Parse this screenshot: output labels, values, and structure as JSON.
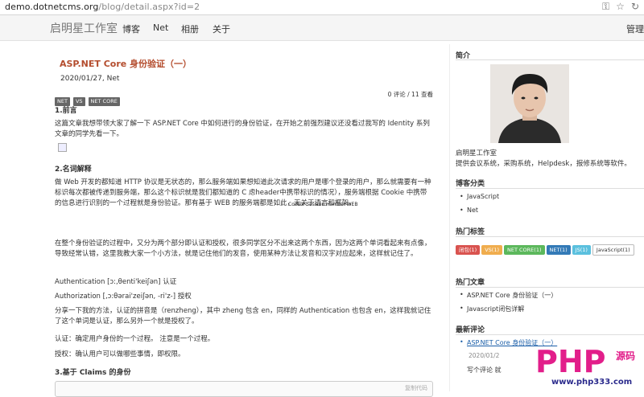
{
  "browser": {
    "url_host": "demo.dotnetcms.org",
    "url_path": "/blog/detail.aspx?id=2"
  },
  "nav": {
    "brand": "启明星工作室",
    "links": [
      "博客",
      "Net",
      "相册",
      "关于"
    ],
    "right": "管理"
  },
  "article": {
    "title": "ASP.NET Core 身份验证（一）",
    "date": "2020/01/27, Net",
    "tags": [
      "NET",
      "VS",
      "NET CORE"
    ],
    "meta": "0 评论 / 11 查看",
    "h1": "1.前言",
    "p1": "这篇文章我想带领大家了解一下 ASP.NET Core 中如何进行的身份验证，在开始之前强烈建议还没看过我写的 Identity 系列文章的同学先看一下。",
    "h2": "2.名词解释",
    "p2": "做 Web 开发的都知道 HTTP 协议是无状态的，那么服务端如果想知道此次请求的用户是哪个登录的用户，那么就需要有一种标识每次都被传递到服务端，那么这个标识就是我们都知道的 C                               虑header中携带标识的情况），服务端根据 Cookie 中携带的信息进行识别的一个过程就是身份验证。那有基于 WEB 的服务端都是如此，无关于语言和框架。",
    "overlay": "Cookie  Session Handler WEB",
    "p3": "在整个身份验证的过程中，又分为两个部分即认证和授权，很多同学区分不出来这两个东西，因为这两个单词看起来有点像，导致经常认错，这里我教大家一个小方法，就是记住他们的发音，使用某种方法让发音和汉字对应起来，这样就记住了。",
    "p4": "Authentication [ɔ:,θenti'keiʃən] 认证",
    "p5": "Authorization [,ɔ:θərai'zeiʃən, -ri'z-] 授权",
    "p6": "分享一下我的方法，认证的拼音是（renzheng），其中 zheng 包含 en，同样的 Authentication 也包含 en，这样我就记住了这个单词是认证，那么另外一个就是授权了。",
    "p7": "认证：确定用户身份的一个过程。 注意是一个过程。",
    "p8": "授权：确认用户可以做哪些事情，即权限。",
    "h3": "3.基于 Claims 的身份",
    "copy": "复制代码"
  },
  "sidebar": {
    "intro_title": "简介",
    "intro_name": "启明星工作室",
    "intro_desc": "提供会议系统，采购系统，Helpdesk，报修系统等软件。",
    "cats_title": "博客分类",
    "cats": [
      "JavaScript",
      "Net"
    ],
    "tags_title": "热门标签",
    "tags": [
      {
        "label": "闭包(1)",
        "color": "#d9534f"
      },
      {
        "label": "VS(1)",
        "color": "#f0ad4e"
      },
      {
        "label": "NET CORE(1)",
        "color": "#5cb85c"
      },
      {
        "label": "NET(1)",
        "color": "#337ab7"
      },
      {
        "label": "JS(1)",
        "color": "#5bc0de"
      },
      {
        "label": "JavaScript(1)",
        "color": ""
      }
    ],
    "posts_title": "热门文章",
    "posts": [
      "ASP.NET Core 身份验证（一）",
      "Javascript闭包详解"
    ],
    "comments_title": "最新评论",
    "comment_link": "ASP.NET Core 身份验证（一）",
    "comment_date": "2020/01/2",
    "comment_text": "写个评论 就"
  },
  "watermark": {
    "text": "PHP",
    "sub": "源码",
    "url": "www.php333.com"
  }
}
